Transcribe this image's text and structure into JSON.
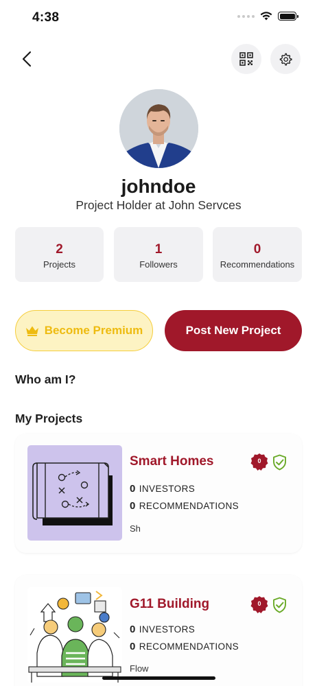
{
  "status_bar": {
    "time": "4:38"
  },
  "header": {
    "back_icon": "chevron-left-icon",
    "qr_icon": "qr-code-icon",
    "settings_icon": "gear-icon"
  },
  "profile": {
    "username": "johndoe",
    "headline": "Project Holder at John Servces"
  },
  "stats": [
    {
      "value": "2",
      "label": "Projects"
    },
    {
      "value": "1",
      "label": "Followers"
    },
    {
      "value": "0",
      "label": "Recommendations"
    }
  ],
  "actions": {
    "premium_label": "Become Premium",
    "post_label": "Post New Project"
  },
  "sections": {
    "about_title": "Who am I?",
    "projects_title": "My Projects"
  },
  "projects": [
    {
      "title": "Smart Homes",
      "badge_count": "0",
      "investors": "0",
      "investors_label": "INVESTORS",
      "recommendations": "0",
      "recommendations_label": "RECOMMENDATIONS",
      "tag": "Sh"
    },
    {
      "title": "G11 Building",
      "badge_count": "0",
      "investors": "0",
      "investors_label": "INVESTORS",
      "recommendations": "0",
      "recommendations_label": "RECOMMENDATIONS",
      "tag": "Flow"
    }
  ],
  "colors": {
    "accent": "#a0182a",
    "premium_text": "#eebb10",
    "premium_bg": "#fdf3c3",
    "verified": "#6aaa28",
    "stat_bg": "#f1f1f3"
  }
}
